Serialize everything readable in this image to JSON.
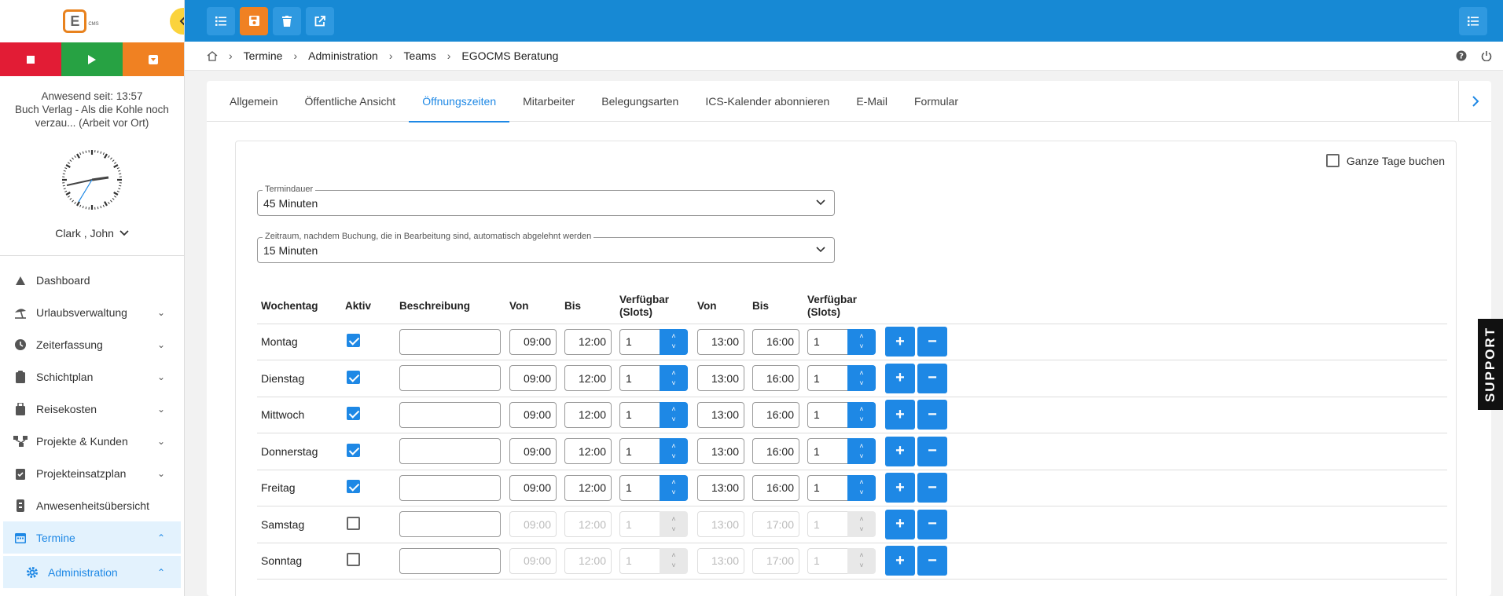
{
  "sidebar": {
    "logo_text": "E",
    "logo_sub": "CMS",
    "presence_since": "Anwesend seit: 13:57",
    "presence_project": "Buch Verlag - Als die Kohle noch verzau... (Arbeit vor Ort)",
    "user_name": "Clark , John",
    "nav": [
      {
        "label": "Dashboard",
        "icon": "speedometer-icon"
      },
      {
        "label": "Urlaubsverwaltung",
        "icon": "beach-umbrella-icon"
      },
      {
        "label": "Zeiterfassung",
        "icon": "clock-icon"
      },
      {
        "label": "Schichtplan",
        "icon": "clipboard-icon"
      },
      {
        "label": "Reisekosten",
        "icon": "suitcase-icon"
      },
      {
        "label": "Projekte & Kunden",
        "icon": "network-icon"
      },
      {
        "label": "Projekteinsatzplan",
        "icon": "clipboard-check-icon"
      },
      {
        "label": "Anwesenheitsübersicht",
        "icon": "id-badge-icon"
      },
      {
        "label": "Termine",
        "icon": "calendar-icon"
      },
      {
        "label": "Administration",
        "icon": "gear-icon"
      }
    ]
  },
  "breadcrumb": [
    "Termine",
    "Administration",
    "Teams",
    "EGOCMS Beratung"
  ],
  "tabs": [
    "Allgemein",
    "Öffentliche Ansicht",
    "Öffnungszeiten",
    "Mitarbeiter",
    "Belegungsarten",
    "ICS-Kalender abonnieren",
    "E-Mail",
    "Formular"
  ],
  "active_tab": "Öffnungszeiten",
  "fullday_label": "Ganze Tage buchen",
  "duration": {
    "label": "Termindauer",
    "value": "45 Minuten"
  },
  "auto_reject": {
    "label": "Zeitraum, nachdem Buchung, die in Bearbeitung sind, automatisch abgelehnt werden",
    "value": "15 Minuten"
  },
  "table": {
    "headers": {
      "day": "Wochentag",
      "active": "Aktiv",
      "desc": "Beschreibung",
      "from": "Von",
      "to": "Bis",
      "slots": "Verfügbar (Slots)"
    },
    "rows": [
      {
        "day": "Montag",
        "active": true,
        "from1": "09:00",
        "to1": "12:00",
        "slots1": "1",
        "from2": "13:00",
        "to2": "16:00",
        "slots2": "1"
      },
      {
        "day": "Dienstag",
        "active": true,
        "from1": "09:00",
        "to1": "12:00",
        "slots1": "1",
        "from2": "13:00",
        "to2": "16:00",
        "slots2": "1"
      },
      {
        "day": "Mittwoch",
        "active": true,
        "from1": "09:00",
        "to1": "12:00",
        "slots1": "1",
        "from2": "13:00",
        "to2": "16:00",
        "slots2": "1"
      },
      {
        "day": "Donnerstag",
        "active": true,
        "from1": "09:00",
        "to1": "12:00",
        "slots1": "1",
        "from2": "13:00",
        "to2": "16:00",
        "slots2": "1"
      },
      {
        "day": "Freitag",
        "active": true,
        "from1": "09:00",
        "to1": "12:00",
        "slots1": "1",
        "from2": "13:00",
        "to2": "16:00",
        "slots2": "1"
      },
      {
        "day": "Samstag",
        "active": false,
        "from1": "09:00",
        "to1": "12:00",
        "slots1": "1",
        "from2": "13:00",
        "to2": "17:00",
        "slots2": "1"
      },
      {
        "day": "Sonntag",
        "active": false,
        "from1": "09:00",
        "to1": "12:00",
        "slots1": "1",
        "from2": "13:00",
        "to2": "17:00",
        "slots2": "1"
      }
    ]
  },
  "support_label": "SUPPORT",
  "colors": {
    "primary": "#1e88e5",
    "topbar": "#1789d4",
    "stop": "#e21c35",
    "play": "#27a243",
    "orange": "#f08122",
    "yellow": "#fbd33c"
  }
}
